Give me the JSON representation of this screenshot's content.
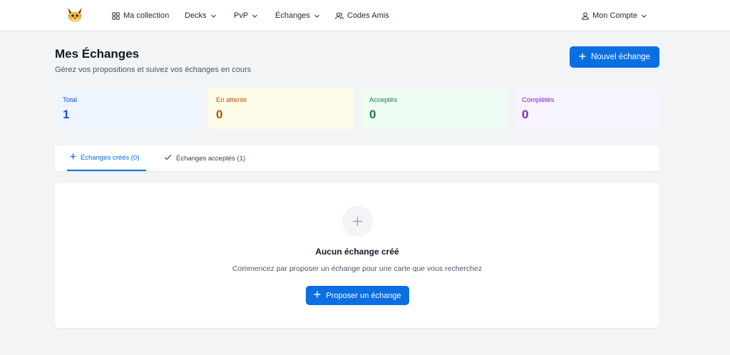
{
  "nav": {
    "logo_icon": "fox-logo-icon",
    "collection": {
      "label": "Ma collection",
      "icon": "grid-icon"
    },
    "decks": {
      "label": "Decks",
      "icon": "chevron-down-icon"
    },
    "pvp": {
      "label": "PvP",
      "icon": "chevron-down-icon"
    },
    "echanges": {
      "label": "Échanges",
      "icon": "chevron-down-icon"
    },
    "codes": {
      "label": "Codes Amis",
      "icon": "users-icon"
    },
    "account": {
      "label": "Mon Compte",
      "icon": "user-icon"
    }
  },
  "header": {
    "title": "Mes Échanges",
    "subtitle": "Gérez vos propositions et suivez vos échanges en cours",
    "new_button": "Nouvel échange"
  },
  "stats": [
    {
      "label": "Total",
      "value": "1",
      "bg": "#eef5ff",
      "color": "#1d4ed8"
    },
    {
      "label": "En attente",
      "value": "0",
      "bg": "#fefbe8",
      "color": "#b45309"
    },
    {
      "label": "Acceptés",
      "value": "0",
      "bg": "#effcf3",
      "color": "#15803d"
    },
    {
      "label": "Complétés",
      "value": "0",
      "bg": "#f8f4ff",
      "color": "#7e22ce"
    }
  ],
  "tabs": {
    "created": "Échanges créés (0)",
    "accepted": "Échanges acceptés (1)"
  },
  "empty": {
    "icon": "plus-icon",
    "title": "Aucun échange créé",
    "description": "Commencez par proposer un échange pour une carte que vous recherchez",
    "button": "Proposer un échange"
  },
  "colors": {
    "accent": "#0a6fe3",
    "page_bg": "#f3f4f6"
  }
}
